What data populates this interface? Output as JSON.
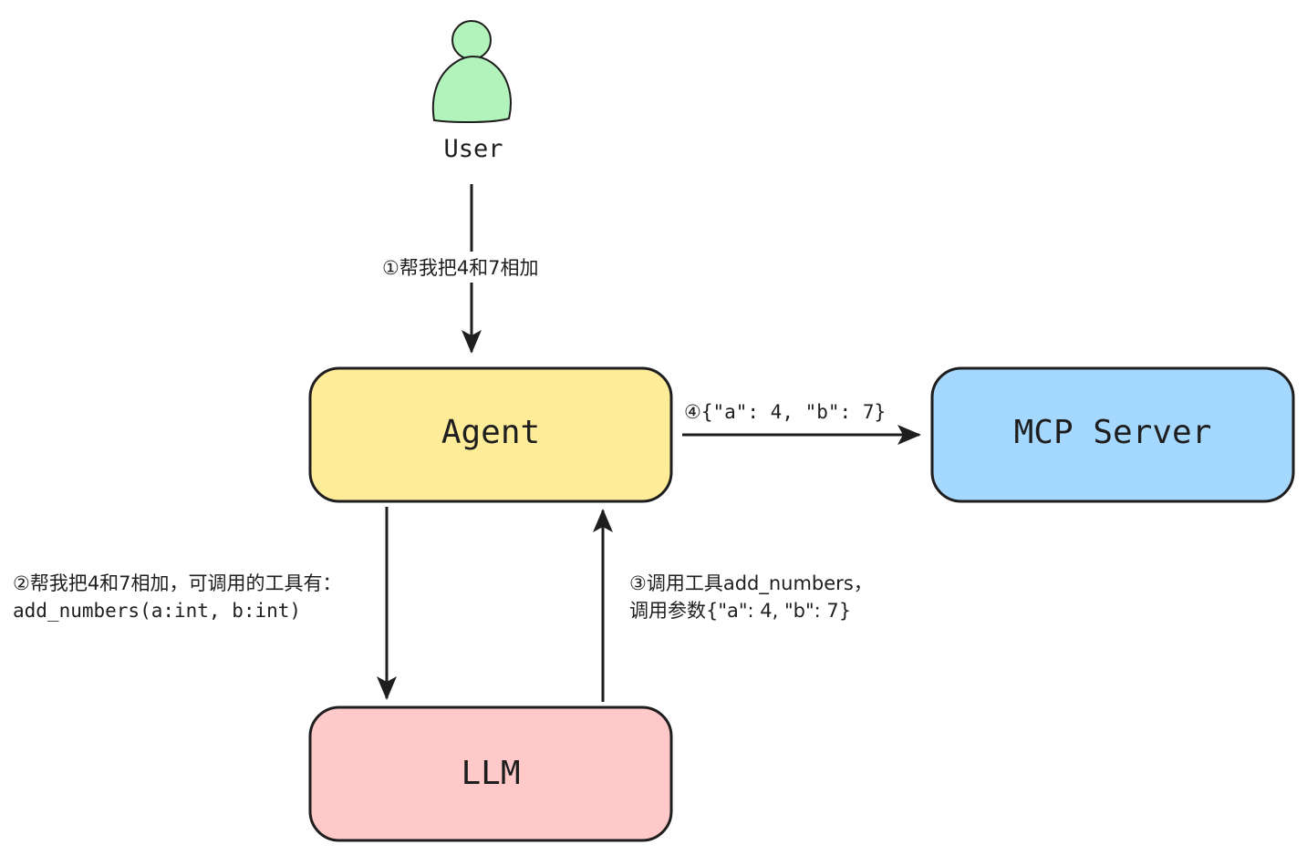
{
  "nodes": {
    "user": {
      "label": "User",
      "color": "#b2f2bb"
    },
    "agent": {
      "label": "Agent",
      "color": "#ffec99"
    },
    "mcp_server": {
      "label": "MCP Server",
      "color": "#a5d8ff"
    },
    "llm": {
      "label": "LLM",
      "color": "#ffc9c9"
    }
  },
  "edges": {
    "step1": {
      "text": "①帮我把4和7相加"
    },
    "step2": {
      "line1": "②帮我把4和7相加，可调用的工具有：",
      "line2": "add_numbers(a:int, b:int)"
    },
    "step3": {
      "line1": "③调用工具add_numbers，",
      "line2": "调用参数{\"a\": 4, \"b\": 7}"
    },
    "step4": {
      "text": "④{\"a\": 4, \"b\": 7}"
    }
  },
  "stroke_color": "#1e1e1e"
}
